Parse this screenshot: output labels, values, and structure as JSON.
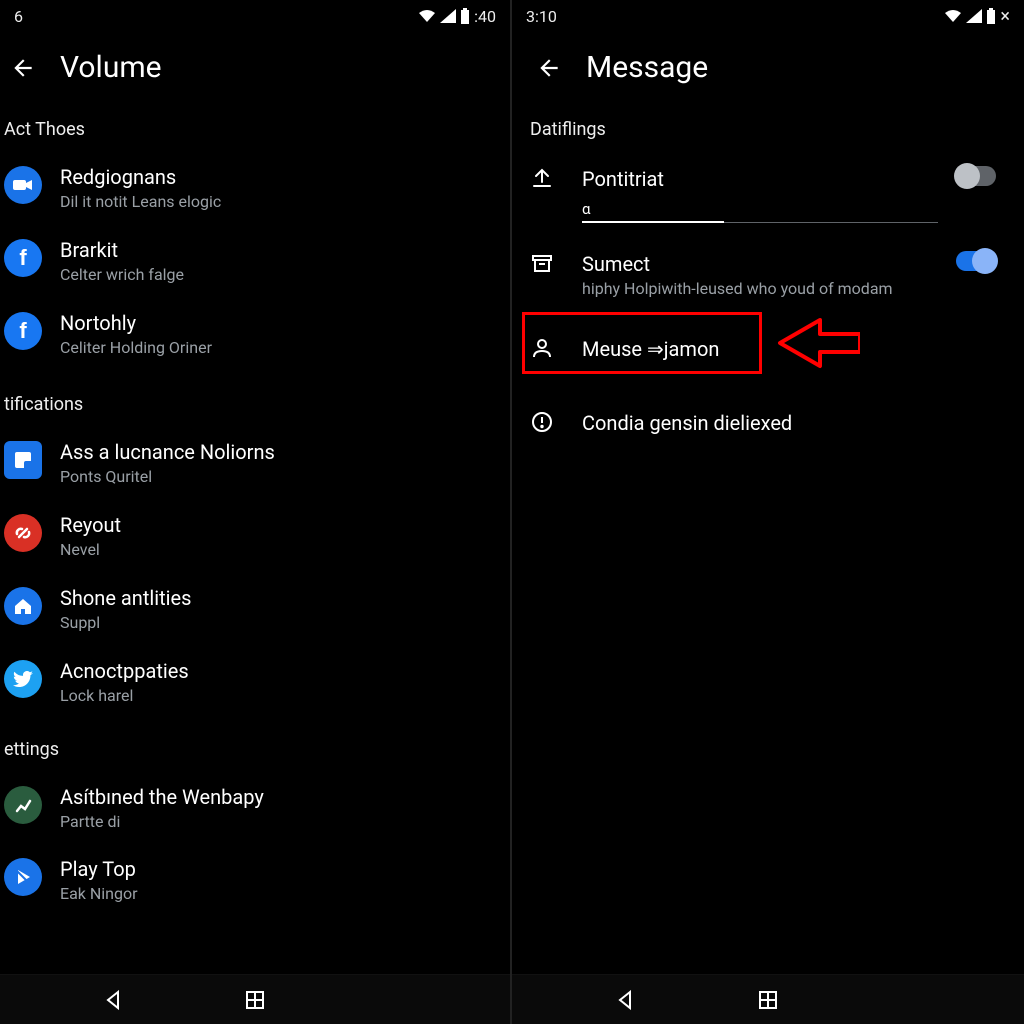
{
  "left": {
    "status_time_left": "6",
    "status_time_right": ":40",
    "title": "Volume",
    "sections": [
      {
        "label": "Act Thoes",
        "items": [
          {
            "title": "Redgiognans",
            "sub": "Dil it notit Leans elogic",
            "icon": "camera",
            "iconClass": "icon-blue"
          },
          {
            "title": "Brarkit",
            "sub": "Celter wrich falge",
            "icon": "f",
            "iconClass": "icon-fb"
          },
          {
            "title": "Nortohly",
            "sub": "Celiter Holding Oriner",
            "icon": "f",
            "iconClass": "icon-fb"
          }
        ]
      },
      {
        "label": "tifications",
        "items": [
          {
            "title": "Ass a lucnance Noliorns",
            "sub": "Ponts Quritel",
            "icon": "notif",
            "iconClass": "icon-blue"
          },
          {
            "title": "Reyout",
            "sub": "Nevel",
            "icon": "link",
            "iconClass": "icon-red"
          },
          {
            "title": "Shone antlities",
            "sub": "Suppl",
            "icon": "home",
            "iconClass": "icon-blue"
          },
          {
            "title": "Acnoctppaties",
            "sub": "Lock harel",
            "icon": "twitter",
            "iconClass": "icon-twitter"
          }
        ]
      },
      {
        "label": "ettings",
        "items": [
          {
            "title": "Asítbıned the Wenbapy",
            "sub": "Partte di",
            "icon": "chart",
            "iconClass": "icon-green"
          },
          {
            "title": "Play Top",
            "sub": "Eak Ningor",
            "icon": "play",
            "iconClass": "icon-blue"
          }
        ]
      }
    ]
  },
  "right": {
    "status_time": "3:10",
    "title": "Message",
    "section_label": "Datiflings",
    "items": {
      "pontitriat": {
        "title": "Pontitriat",
        "value": "α"
      },
      "sumect": {
        "title": "Sumect",
        "sub": "hiphy Holpiwith-leused who youd of modam"
      },
      "meuse": {
        "title": "Meuse ⇒jamon"
      },
      "condia": {
        "title": "Condia gensin dieliexed"
      }
    }
  },
  "colors": {
    "accent_blue": "#1a73e8",
    "highlight_red": "#ff0000"
  }
}
